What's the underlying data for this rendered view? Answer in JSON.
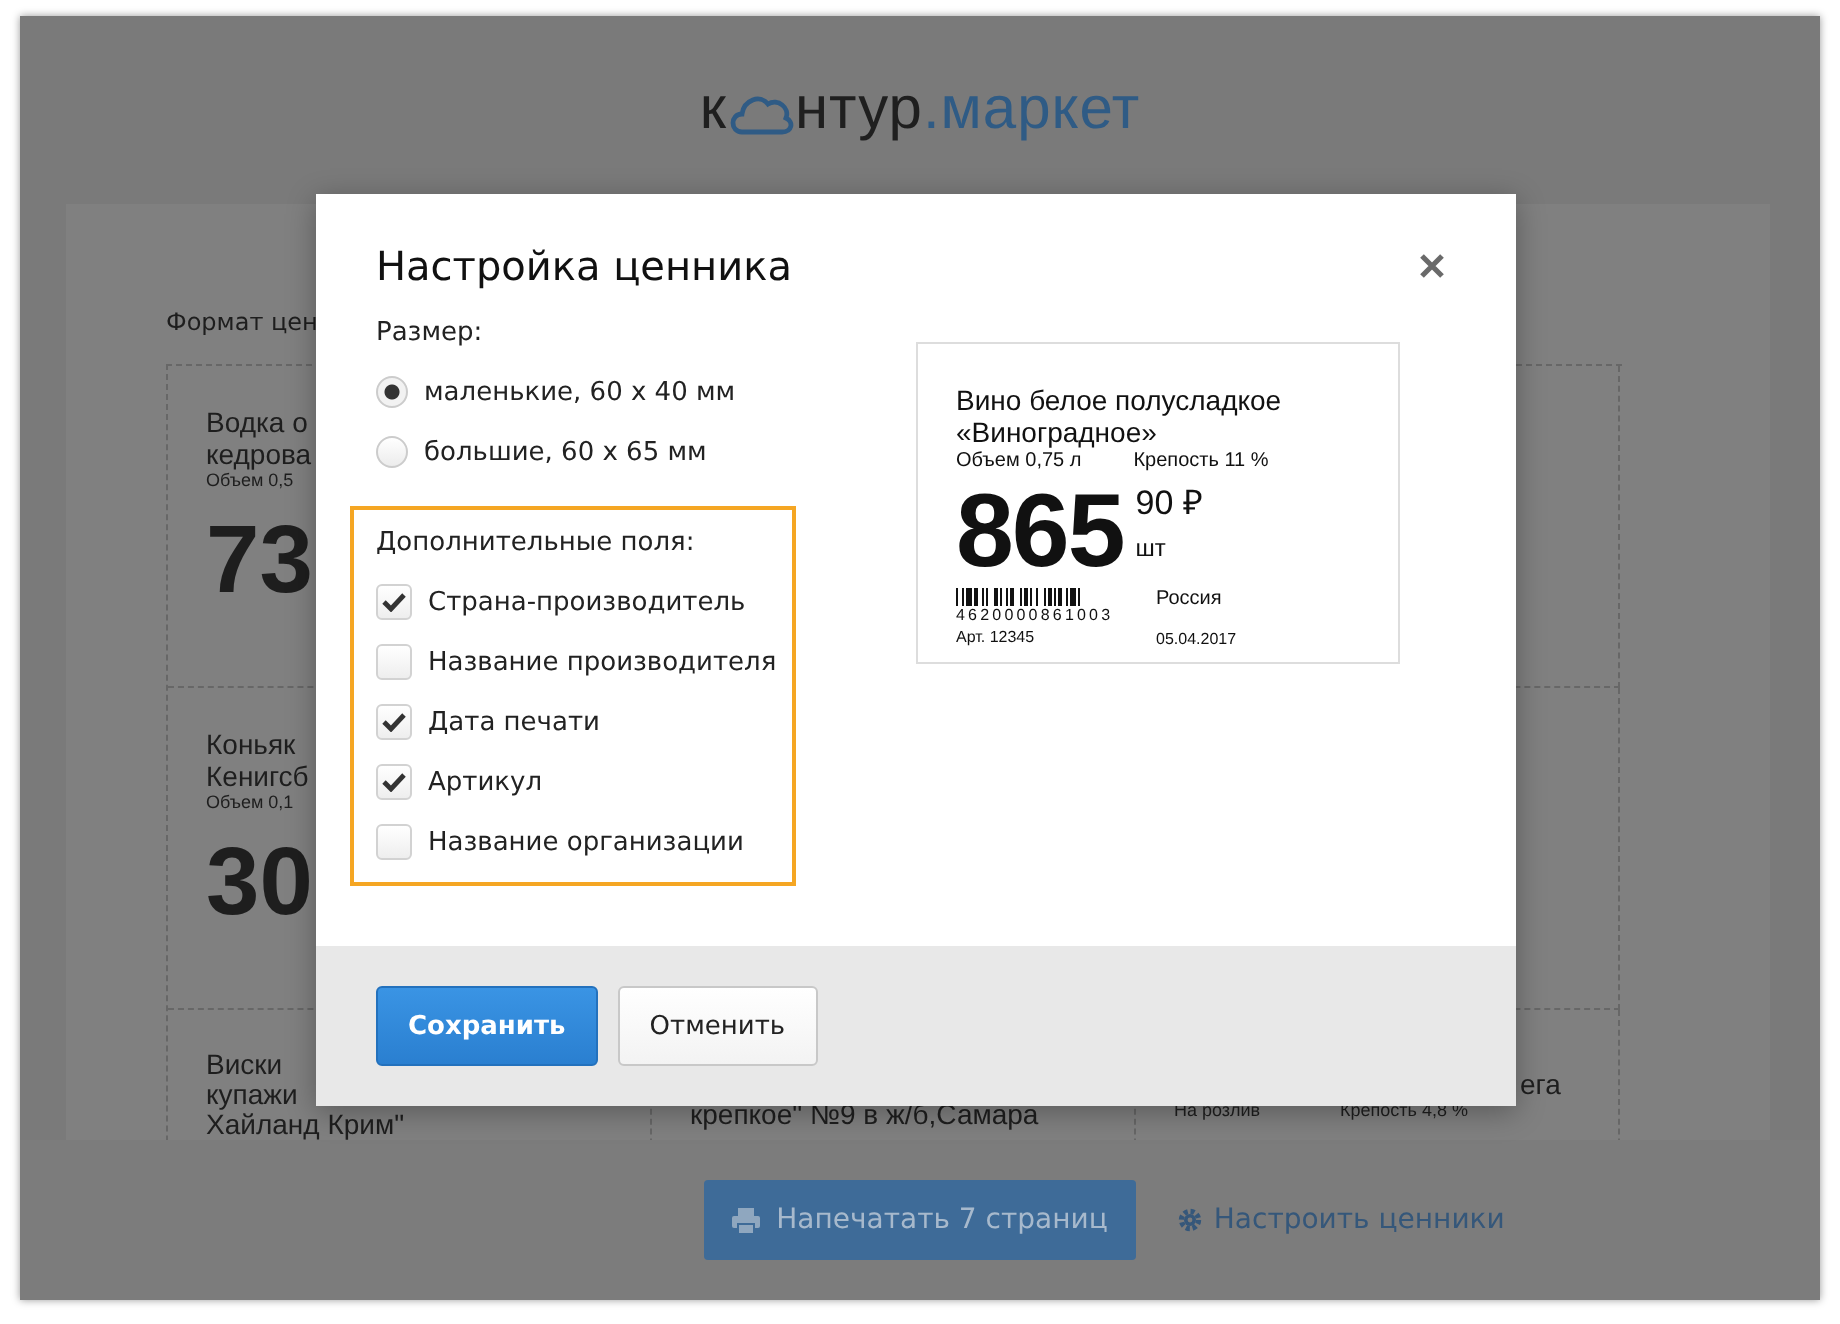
{
  "logo": {
    "start": "к",
    "end": "нтур",
    "domain": ".маркет"
  },
  "page": {
    "format_label": "Формат цен",
    "rows": [
      {
        "cells": [
          {
            "title": [
              "Водка о",
              "кедрова"
            ],
            "details": [
              "Объем 0,5"
            ],
            "price": "73"
          }
        ]
      },
      {
        "cells": [
          {
            "title": [
              "Коньяк",
              "Кенигсб"
            ],
            "details": [
              "Объем 0,1"
            ],
            "price": "30"
          }
        ]
      },
      {
        "cells": [
          {
            "title": [
              "Виски",
              "купажи",
              "Хайланд Крим\""
            ]
          },
          {
            "title": [
              "крепкое\" №9 в ж/б,Самара"
            ]
          },
          {
            "title": [
              "ега"
            ],
            "details": [
              "На розлив",
              "Крепость 4,8 %"
            ]
          }
        ]
      }
    ]
  },
  "footer": {
    "print_button": "Напечатать 7 страниц",
    "settings_link": "Настроить ценники"
  },
  "dialog": {
    "title": "Настройка ценника",
    "size_label": "Размер:",
    "size_options": [
      {
        "label": "маленькие, 60 x 40 мм",
        "selected": true
      },
      {
        "label": "большие, 60 x 65 мм",
        "selected": false
      }
    ],
    "extra_fields_label": "Дополнительные поля:",
    "extra_fields": [
      {
        "label": "Страна-производитель",
        "checked": true
      },
      {
        "label": "Название производителя",
        "checked": false
      },
      {
        "label": "Дата печати",
        "checked": true
      },
      {
        "label": "Артикул",
        "checked": true
      },
      {
        "label": "Название организации",
        "checked": false
      }
    ],
    "preview": {
      "title": "Вино белое полусладкое «Виноградное»",
      "volume": "Объем 0,75 л",
      "strength": "Крепость 11 %",
      "price_main": "865",
      "price_cents": "90 ₽",
      "unit": "шт",
      "barcode_number": "4620000861003",
      "article": "Арт. 12345",
      "country": "Россия",
      "print_date": "05.04.2017"
    },
    "buttons": [
      {
        "label": "Сохранить",
        "kind": "primary"
      },
      {
        "label": "Отменить",
        "kind": "secondary"
      }
    ]
  }
}
